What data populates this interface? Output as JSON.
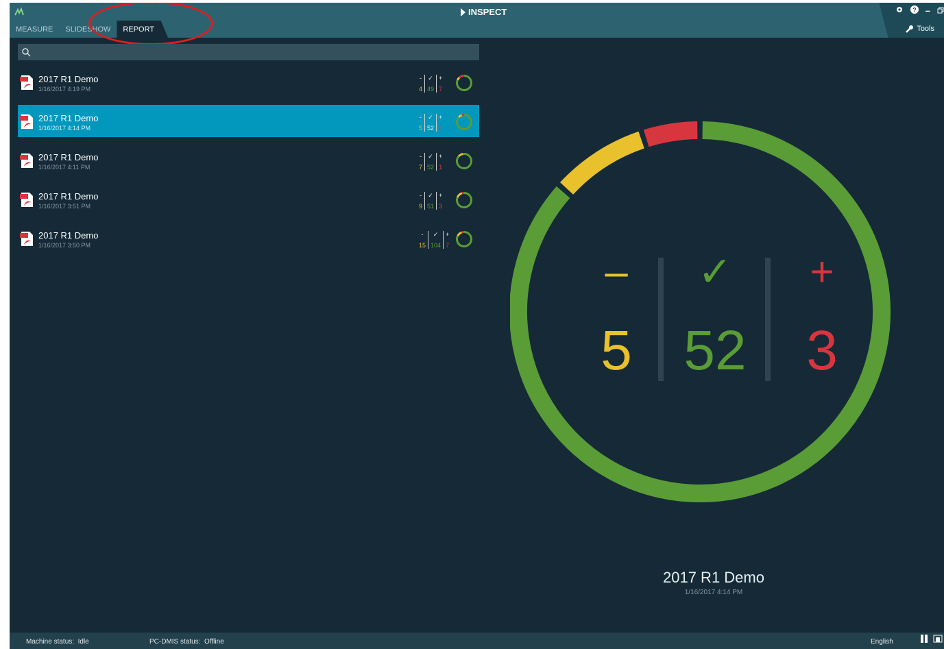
{
  "app": {
    "title": "INSPECT"
  },
  "tabs": [
    {
      "label": "MEASURE",
      "active": false
    },
    {
      "label": "SLIDESHOW",
      "active": false
    },
    {
      "label": "REPORT",
      "active": true
    }
  ],
  "toolbar": {
    "tools_label": "Tools"
  },
  "search": {
    "placeholder": ""
  },
  "reports": [
    {
      "title": "2017 R1 Demo",
      "date": "1/16/2017  4:19 PM",
      "minus": "4",
      "ok": "49",
      "plus": "7",
      "selected": false
    },
    {
      "title": "2017 R1 Demo",
      "date": "1/16/2017  4:14 PM",
      "minus": "5",
      "ok": "52",
      "plus": "3",
      "selected": true
    },
    {
      "title": "2017 R1 Demo",
      "date": "1/16/2017  4:11 PM",
      "minus": "7",
      "ok": "52",
      "plus": "1",
      "selected": false
    },
    {
      "title": "2017 R1 Demo",
      "date": "1/16/2017  3:51 PM",
      "minus": "9",
      "ok": "51",
      "plus": "3",
      "selected": false
    },
    {
      "title": "2017 R1 Demo",
      "date": "1/16/2017  3:50 PM",
      "minus": "15",
      "ok": "104",
      "plus": "7",
      "selected": false
    }
  ],
  "stat_symbols": {
    "minus": "-",
    "ok": "✓",
    "plus": "+"
  },
  "detail": {
    "title": "2017 R1 Demo",
    "date": "1/16/2017  4:14 PM",
    "minus_symbol": "–",
    "ok_symbol": "✓",
    "plus_symbol": "+",
    "minus": "5",
    "ok": "52",
    "plus": "3"
  },
  "status": {
    "machine_label": "Machine status:",
    "machine_value": "Idle",
    "pcdmis_label": "PC-DMIS status:",
    "pcdmis_value": "Offline",
    "language": "English"
  },
  "colors": {
    "yellow": "#e8c12c",
    "green": "#5a9c36",
    "red": "#d8363f",
    "selected": "#0298be",
    "header": "#2d6271",
    "background": "#152a36"
  },
  "icons": [
    "app-logo-icon",
    "play-icon",
    "gear-icon",
    "help-icon",
    "minimize-icon",
    "restore-icon",
    "wrench-icon",
    "search-icon",
    "pdf-icon",
    "pause-icon",
    "window-icon"
  ]
}
